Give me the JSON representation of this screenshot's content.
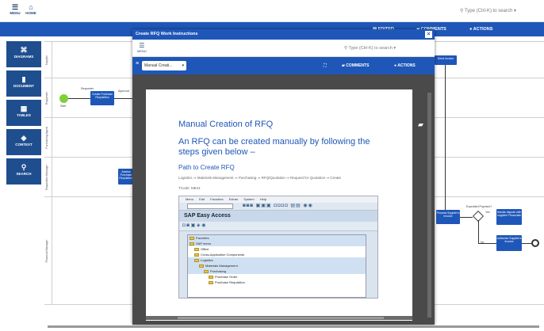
{
  "topbar": {
    "menu_label": "MENU",
    "home_label": "HOME",
    "search_placeholder": "Type (Ctrl-K) to search"
  },
  "bluebar": {
    "status_label": "EDITED",
    "comments_label": "COMMENTS",
    "actions_label": "ACTIONS"
  },
  "leftnav": [
    {
      "label": "DIAGRAMS",
      "icon": "diagram-icon"
    },
    {
      "label": "DOCUMENT",
      "icon": "document-icon"
    },
    {
      "label": "TABLES",
      "icon": "table-icon"
    },
    {
      "label": "CONTEXT",
      "icon": "context-icon"
    },
    {
      "label": "SEARCH",
      "icon": "search-icon"
    }
  ],
  "diagram": {
    "lanes": [
      "Supplier",
      "Requester",
      "Purchasing Agent",
      "Requisition Manager",
      "Financial Manager"
    ],
    "tasks": {
      "create_requisition": "Create Purchase Requisition",
      "send_invoice": "Send Invoice",
      "approve": "Assess Purchase Requisition",
      "process_invoice": "Process Supplier's Invoice",
      "handle_dispute": "Handle dispute with supplier/ Financials",
      "authorize": "Authorize Supplier's Invoice"
    },
    "labels": {
      "start": "Start",
      "requester": "Requester",
      "approval": "Approval",
      "expedited": "Expedited Payment?",
      "yes": "Yes",
      "no": "No"
    }
  },
  "modal": {
    "title": "Create RFQ Work Instructions",
    "close_icon": "close-icon",
    "menu_label": "MENU",
    "search_placeholder": "Type (Ctrl-K) to search",
    "doc_select": "Manual Creati...",
    "comments_label": "COMMENTS",
    "actions_label": "ACTIONS"
  },
  "document": {
    "heading1": "Manual Creation of RFQ",
    "heading2": "An RFQ can be created manually by following the steps given below –",
    "heading3": "Path to Create RFQ",
    "path": "Logistics ⇒ Materials Management ⇒ Purchasing ⇒ RFQ/Quotation ⇒ Request for Quotation ⇒ Create",
    "tcode": "TCode: ME41"
  },
  "sap": {
    "menu": [
      "Menu",
      "Edit",
      "Favorites",
      "Extras",
      "System",
      "Help"
    ],
    "title": "SAP Easy Access",
    "tree": [
      {
        "label": "Favorites",
        "indent": 0,
        "selected": true
      },
      {
        "label": "SAP menu",
        "indent": 0,
        "selected": true
      },
      {
        "label": "Office",
        "indent": 1,
        "selected": false
      },
      {
        "label": "Cross-Application Components",
        "indent": 1,
        "selected": false
      },
      {
        "label": "Logistics",
        "indent": 1,
        "selected": true
      },
      {
        "label": "Materials Management",
        "indent": 2,
        "selected": true
      },
      {
        "label": "Purchasing",
        "indent": 3,
        "selected": true
      },
      {
        "label": "Purchase Order",
        "indent": 4,
        "selected": false
      },
      {
        "label": "Purchase Requisition",
        "indent": 4,
        "selected": false
      }
    ]
  }
}
